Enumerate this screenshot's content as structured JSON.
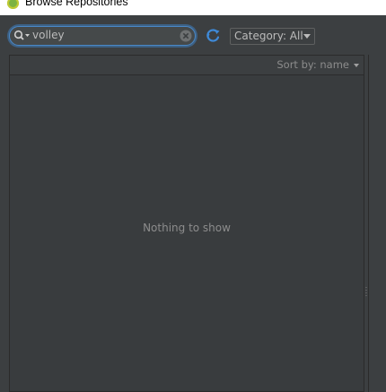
{
  "window": {
    "title": "Browse Repositories",
    "icon": "android-studio-icon"
  },
  "toolbar": {
    "search": {
      "value": "volley",
      "icon": "search-icon",
      "clear_icon": "clear-icon"
    },
    "refresh_icon": "refresh-icon",
    "category": {
      "label": "Category: All"
    }
  },
  "plugin_list": {
    "sort_label": "Sort by: name",
    "empty_text": "Nothing to show"
  },
  "colors": {
    "background": "#3c3f41",
    "focus_ring": "#4a88c7",
    "refresh_icon": "#3f8ad8",
    "text": "#bbbbbb",
    "muted_text": "#8c8c8c"
  }
}
